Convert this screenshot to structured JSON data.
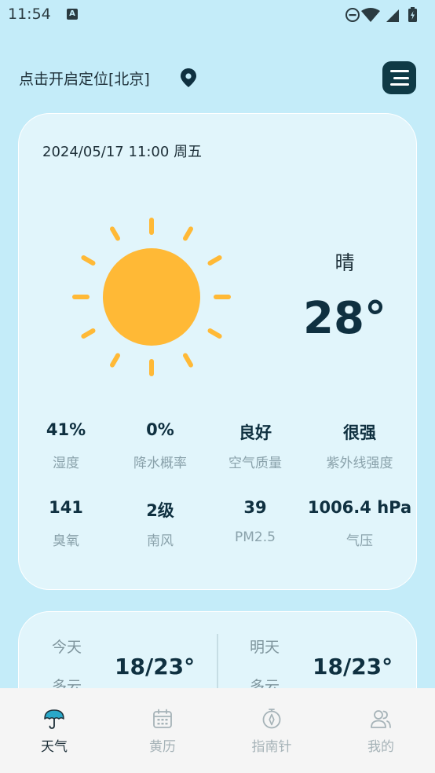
{
  "status_bar": {
    "time": "11:54",
    "notification_letter": "A"
  },
  "header": {
    "location_text": "点击开启定位[北京]"
  },
  "weather": {
    "datetime": "2024/05/17 11:00 周五",
    "condition": "晴",
    "temperature": "28°",
    "stats": [
      {
        "value": "41%",
        "label": "湿度"
      },
      {
        "value": "0%",
        "label": "降水概率"
      },
      {
        "value": "良好",
        "label": "空气质量"
      },
      {
        "value": "很强",
        "label": "紫外线强度"
      },
      {
        "value": "141",
        "label": "臭氧"
      },
      {
        "value": "2级",
        "label": "南风"
      },
      {
        "value": "39",
        "label": "PM2.5"
      },
      {
        "value": "1006.4 hPa",
        "label": "气压"
      }
    ]
  },
  "forecast": {
    "today": {
      "day": "今天",
      "condition": "多云",
      "temp": "18/23°"
    },
    "tomorrow": {
      "day": "明天",
      "condition": "多云",
      "temp": "18/23°"
    }
  },
  "nav": {
    "items": [
      {
        "label": "天气",
        "icon": "umbrella-icon",
        "active": true
      },
      {
        "label": "黄历",
        "icon": "calendar-icon",
        "active": false
      },
      {
        "label": "指南针",
        "icon": "compass-icon",
        "active": false
      },
      {
        "label": "我的",
        "icon": "users-icon",
        "active": false
      }
    ]
  },
  "colors": {
    "background": "#c4ecf9",
    "card": "#e1f5fb",
    "sun": "#ffb936",
    "menu_button": "#0f3a46",
    "active_icon": "#2aa8c9"
  }
}
